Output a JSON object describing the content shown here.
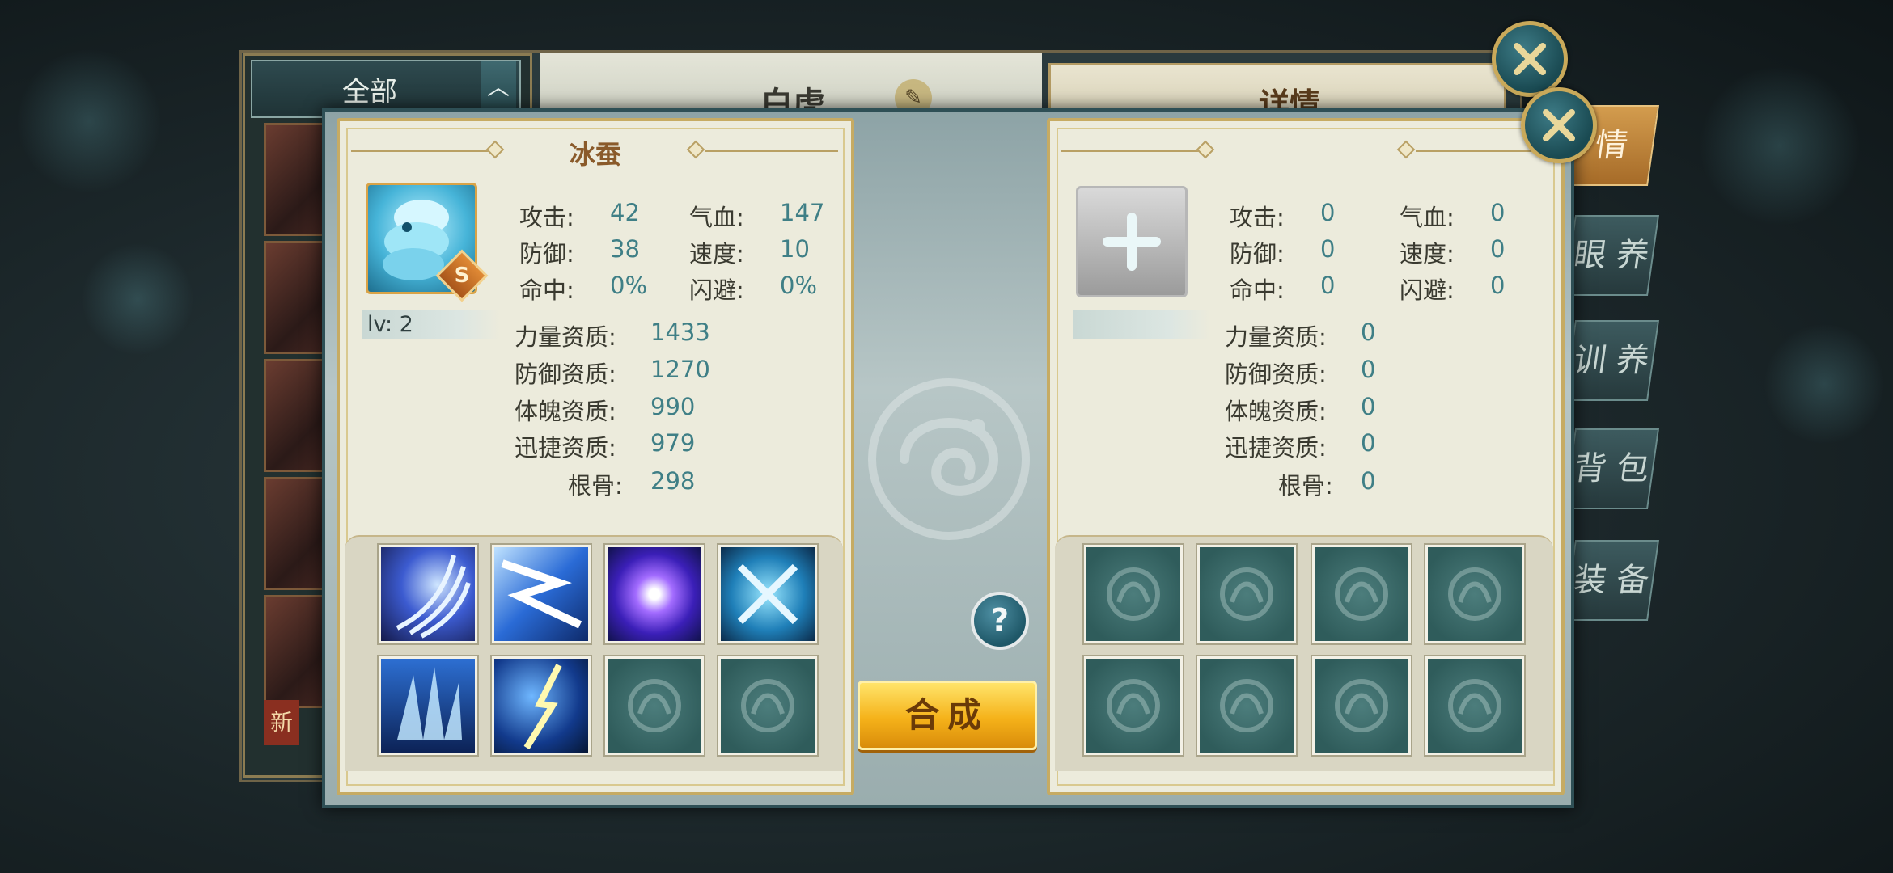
{
  "background": {
    "list_filter": "全部",
    "new_badge": "新",
    "behind_pet_name": "白虎",
    "behind_detail_tab": "详情",
    "side_tabs": [
      "情",
      "眼 养",
      "训 养",
      "背 包",
      "装 备"
    ]
  },
  "left_panel": {
    "title": "冰蚕",
    "grade": "S",
    "level": "lv: 2",
    "stats": {
      "attack_label": "攻击:",
      "attack": "42",
      "hp_label": "气血:",
      "hp": "147",
      "defense_label": "防御:",
      "defense": "38",
      "speed_label": "速度:",
      "speed": "10",
      "hit_label": "命中:",
      "hit": "0%",
      "dodge_label": "闪避:",
      "dodge": "0%"
    },
    "aptitudes": {
      "strength_label": "力量资质:",
      "strength": "1433",
      "defense_label": "防御资质:",
      "defense": "1270",
      "physique_label": "体魄资质:",
      "physique": "990",
      "agility_label": "迅捷资质:",
      "agility": "979",
      "bone_label": "根骨:",
      "bone": "298"
    },
    "skills": [
      "claw-slash-icon",
      "lightning-dash-icon",
      "purple-orb-icon",
      "crossed-chains-icon",
      "ice-spike-icon",
      "lightning-strike-icon",
      "empty",
      "empty"
    ]
  },
  "right_panel": {
    "add_icon": "plus-icon",
    "stats": {
      "attack_label": "攻击:",
      "attack": "0",
      "hp_label": "气血:",
      "hp": "0",
      "defense_label": "防御:",
      "defense": "0",
      "speed_label": "速度:",
      "speed": "0",
      "hit_label": "命中:",
      "hit": "0",
      "dodge_label": "闪避:",
      "dodge": "0"
    },
    "aptitudes": {
      "strength_label": "力量资质:",
      "strength": "0",
      "defense_label": "防御资质:",
      "defense": "0",
      "physique_label": "体魄资质:",
      "physique": "0",
      "agility_label": "迅捷资质:",
      "agility": "0",
      "bone_label": "根骨:",
      "bone": "0"
    }
  },
  "actions": {
    "merge_label": "合成",
    "help_label": "?"
  },
  "colors": {
    "accent_gold": "#c6ab63",
    "stat_value": "#3f7f86",
    "merge_button": "#f5b21a"
  }
}
